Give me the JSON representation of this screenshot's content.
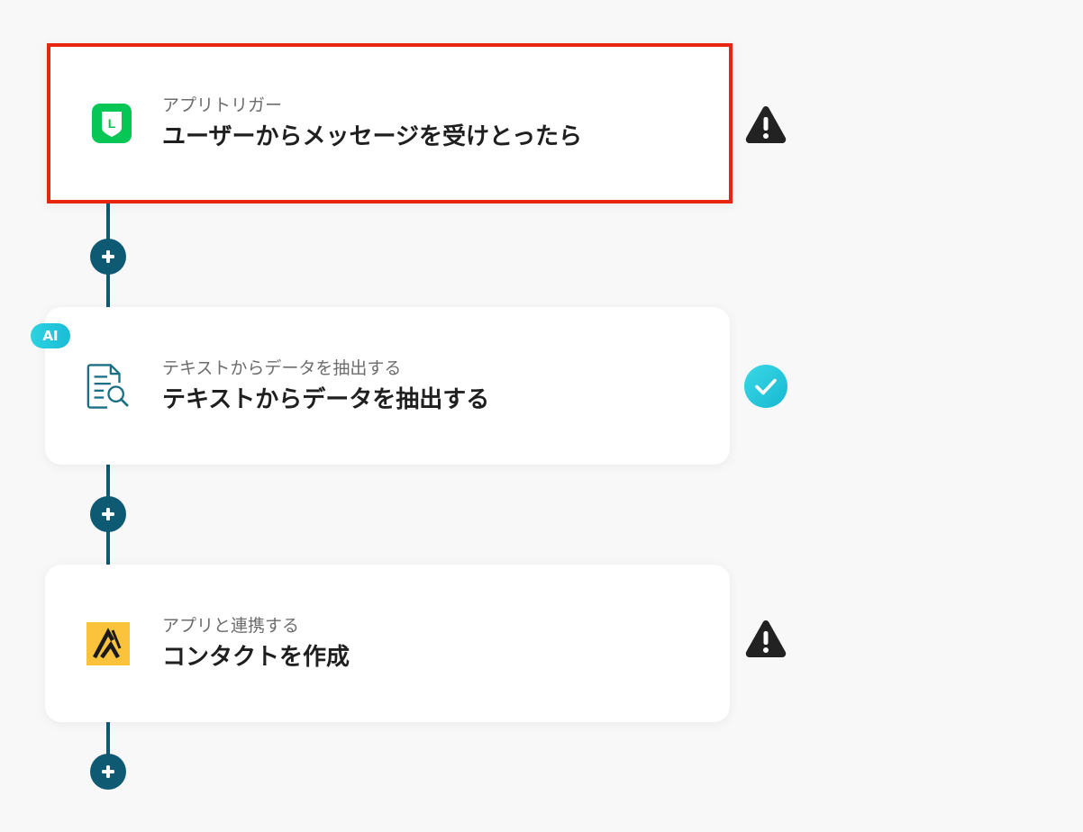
{
  "colors": {
    "background": "#f8f8f8",
    "connector": "#0e5a73",
    "selected_border": "#e8260f",
    "line_green": "#06c755",
    "ai_badge": "#1fc4da",
    "warning": "#222222",
    "success": "#1fc4da"
  },
  "steps": [
    {
      "subtitle": "アプリトリガー",
      "title": "ユーザーからメッセージを受けとったら",
      "icon": "line-app-icon",
      "icon_letter": "L",
      "status": "warning-icon",
      "selected": true
    },
    {
      "badge": "AI",
      "subtitle": "テキストからデータを抽出する",
      "title": "テキストからデータを抽出する",
      "icon": "document-search-icon",
      "status": "check-icon",
      "selected": false
    },
    {
      "subtitle": "アプリと連携する",
      "title": "コンタクトを作成",
      "icon": "crm-app-icon",
      "status": "warning-icon",
      "selected": false
    }
  ],
  "add_buttons": [
    {
      "icon": "plus-icon"
    },
    {
      "icon": "plus-icon"
    },
    {
      "icon": "plus-icon"
    }
  ]
}
